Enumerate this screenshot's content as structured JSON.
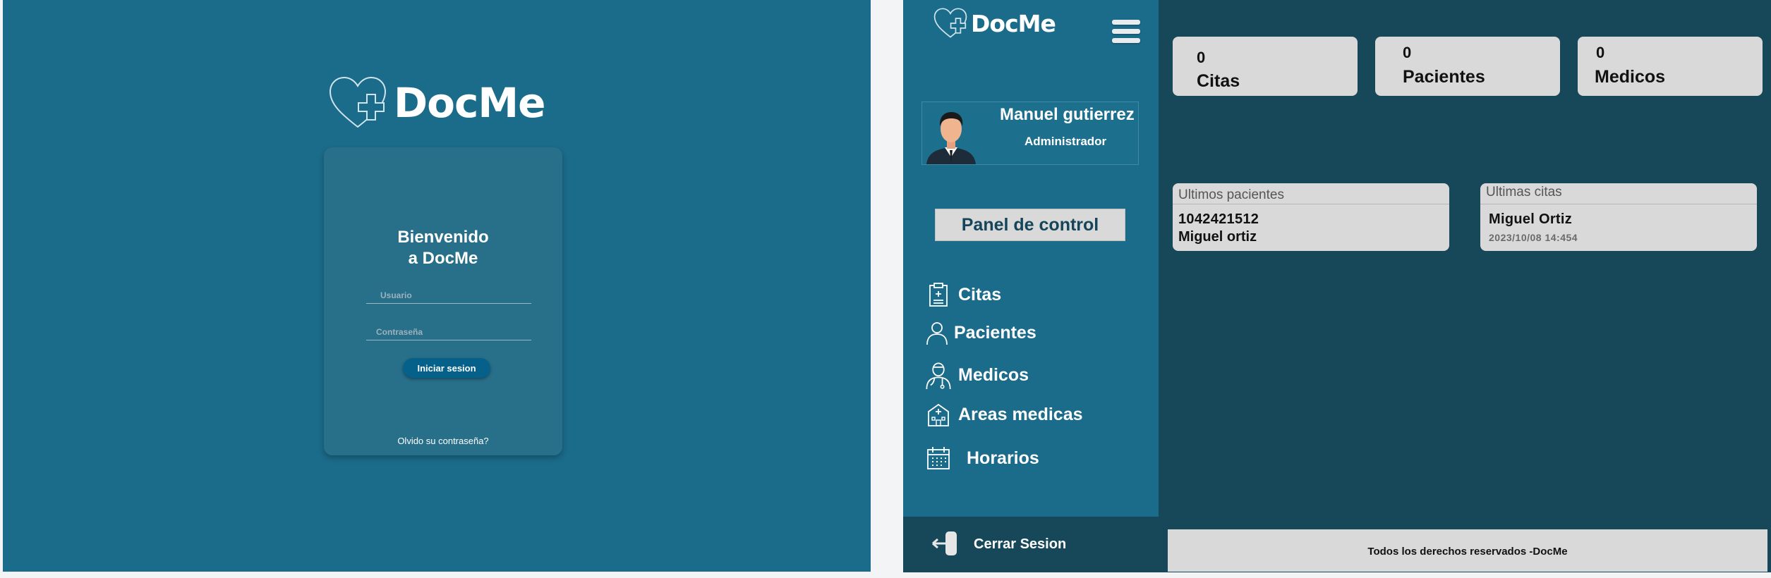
{
  "brand": {
    "name": "DocMe",
    "primary_color": "#1b6b8a",
    "dark_color": "#17485a",
    "card_color": "#d9d9d9"
  },
  "login": {
    "welcome_line1": "Bienvenido",
    "welcome_line2": "a DocMe",
    "username_placeholder": "Usuario",
    "password_placeholder": "Contraseña",
    "submit_label": "Iniciar sesion",
    "forgot_label": "Olvido su contraseña?"
  },
  "sidebar": {
    "menu_icon": "hamburger-icon",
    "user": {
      "name": "Manuel gutierrez",
      "role": "Administrador",
      "avatar": "user-avatar"
    },
    "panel_label": "Panel de control",
    "items": [
      {
        "label": "Citas",
        "icon": "clipboard-icon"
      },
      {
        "label": "Pacientes",
        "icon": "person-icon"
      },
      {
        "label": "Medicos",
        "icon": "doctor-icon"
      },
      {
        "label": "Areas medicas",
        "icon": "hospital-icon"
      },
      {
        "label": "Horarios",
        "icon": "calendar-icon"
      }
    ],
    "logout_label": "Cerrar Sesion"
  },
  "stats": [
    {
      "value": "0",
      "label": "Citas"
    },
    {
      "value": "0",
      "label": "Pacientes"
    },
    {
      "value": "0",
      "label": "Medicos"
    }
  ],
  "recent_patients": {
    "title": "Ultimos pacientes",
    "id": "1042421512",
    "name": "Miguel ortiz"
  },
  "recent_appointments": {
    "title": "Ultimas citas",
    "name": "Miguel Ortiz",
    "datetime": "2023/10/08 14:454"
  },
  "footer": {
    "text": "Todos los derechos reservados -DocMe"
  }
}
